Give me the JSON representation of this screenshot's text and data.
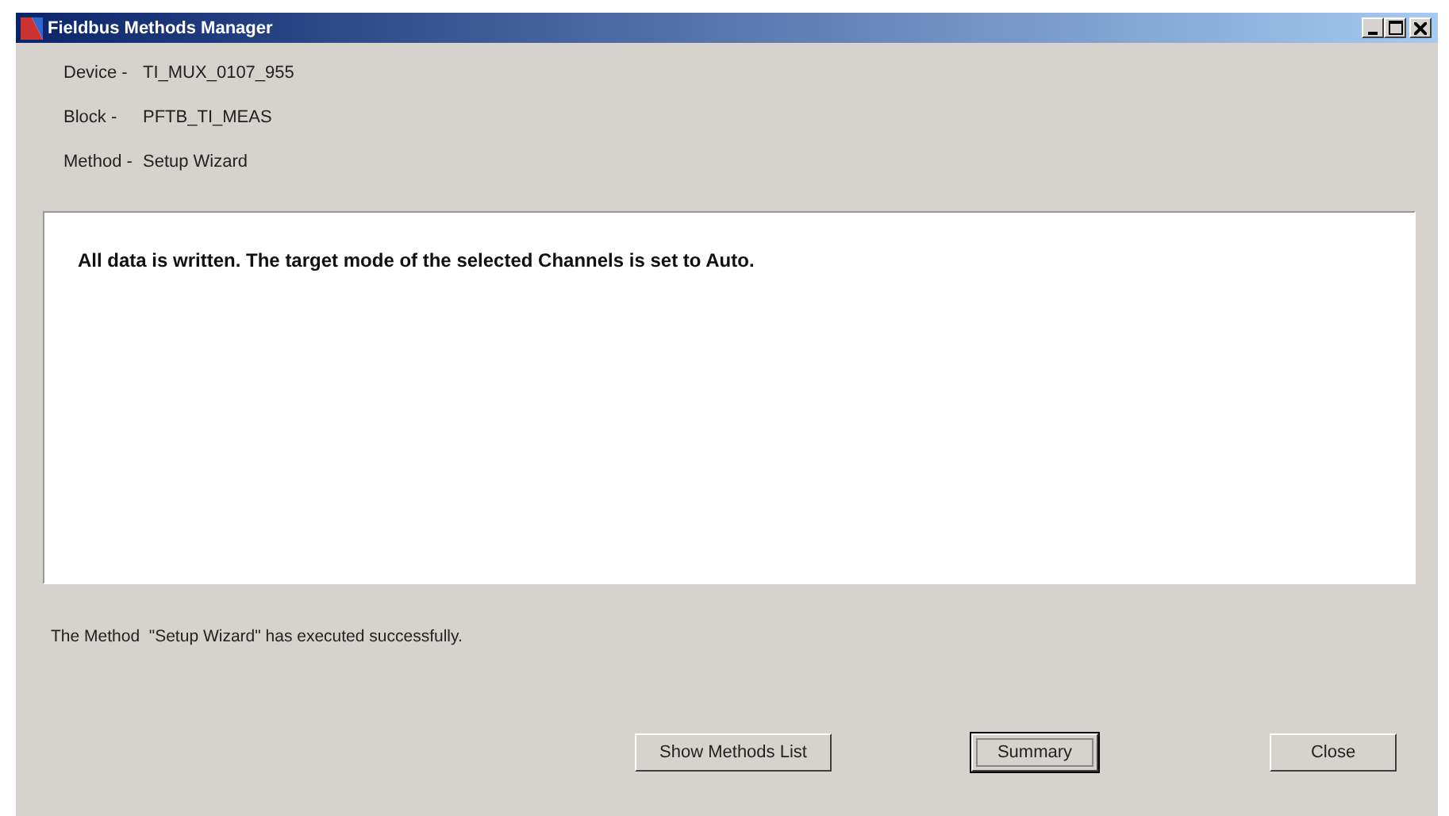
{
  "window": {
    "title": "Fieldbus Methods Manager"
  },
  "info": [
    {
      "label": "Device -",
      "value": "TI_MUX_0107_955"
    },
    {
      "label": "Block -",
      "value": "PFTB_TI_MEAS"
    },
    {
      "label": "Method -",
      "value": "Setup Wizard"
    }
  ],
  "message": "All data is written. The target mode of the selected Channels is set to Auto.",
  "status": "The Method  \"Setup Wizard\" has executed successfully.",
  "buttons": [
    {
      "label": "Show Methods List",
      "default": false
    },
    {
      "label": "Summary",
      "default": true
    },
    {
      "label": "Close",
      "default": false
    }
  ]
}
